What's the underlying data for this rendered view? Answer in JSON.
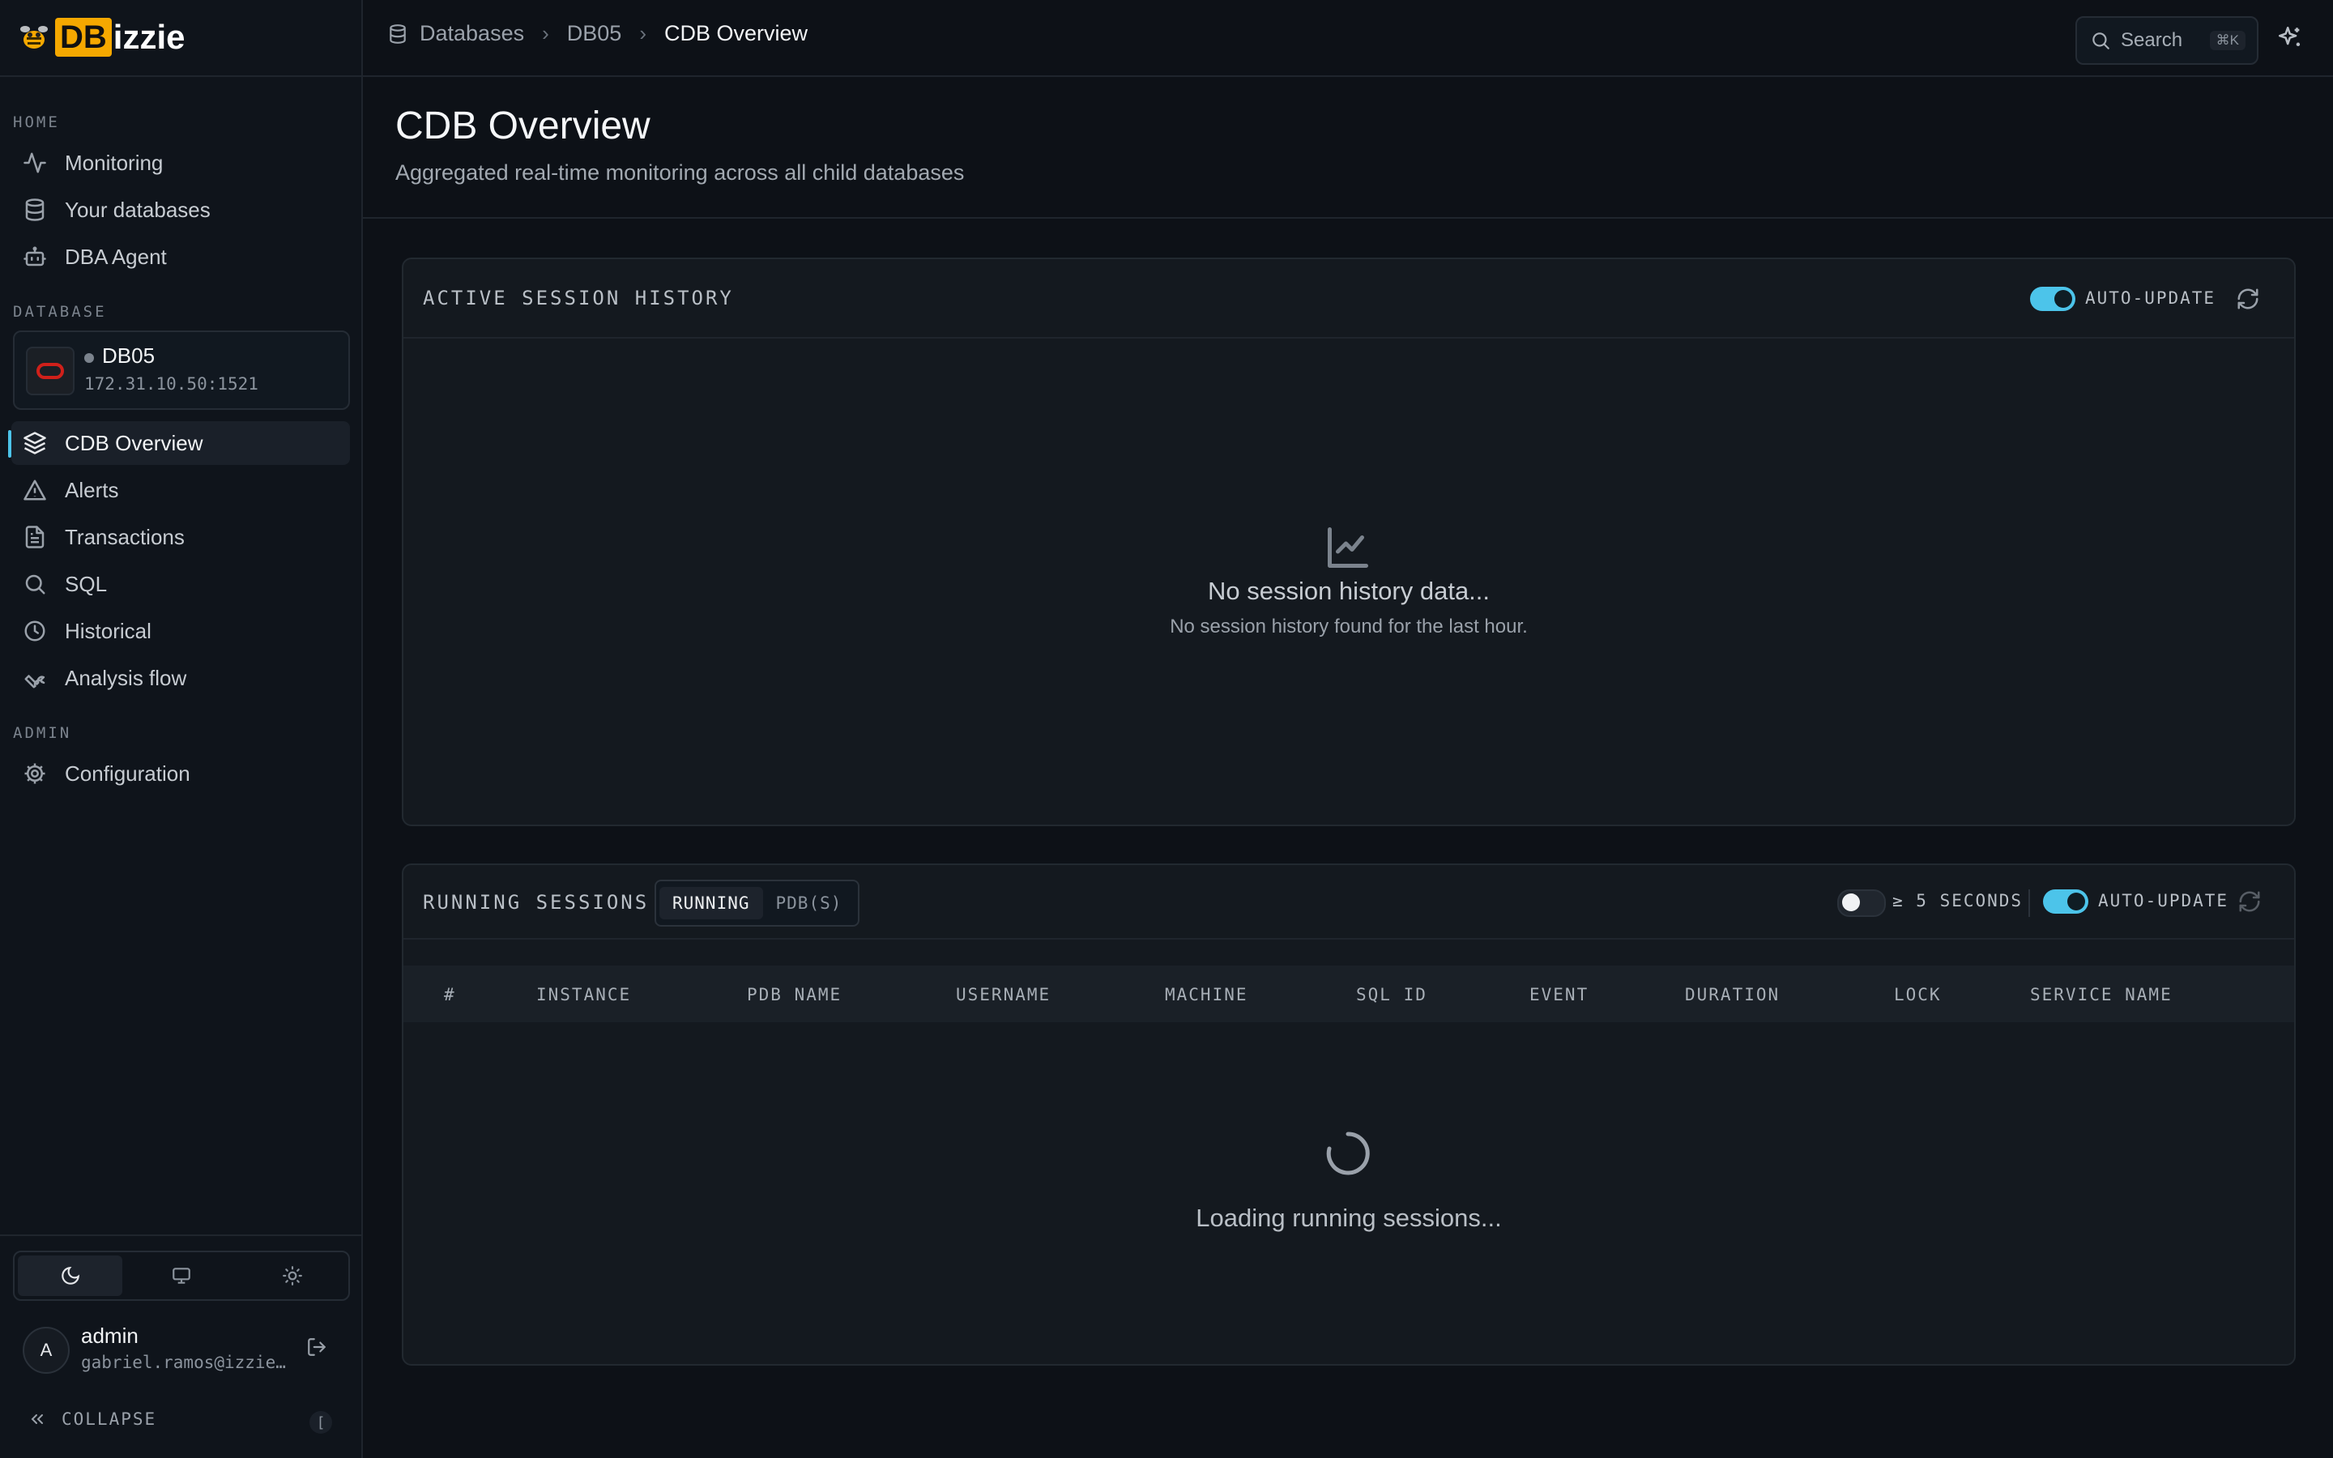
{
  "app": {
    "logo_db": "DB",
    "logo_rest": "izzie"
  },
  "sidebar": {
    "sections": {
      "home": "HOME",
      "database": "DATABASE",
      "admin": "ADMIN"
    },
    "home_items": [
      {
        "label": "Monitoring",
        "icon": "activity-icon"
      },
      {
        "label": "Your databases",
        "icon": "database-icon"
      },
      {
        "label": "DBA Agent",
        "icon": "bot-icon"
      }
    ],
    "database": {
      "name": "DB05",
      "host": "172.31.10.50:1521",
      "status_color": "#7b838d"
    },
    "database_items": [
      {
        "label": "CDB Overview",
        "icon": "layers-icon",
        "active": true
      },
      {
        "label": "Alerts",
        "icon": "alert-triangle-icon"
      },
      {
        "label": "Transactions",
        "icon": "file-text-icon"
      },
      {
        "label": "SQL",
        "icon": "search-icon"
      },
      {
        "label": "Historical",
        "icon": "clock-icon"
      },
      {
        "label": "Analysis flow",
        "icon": "wrench-icon"
      }
    ],
    "admin_items": [
      {
        "label": "Configuration",
        "icon": "gear-icon"
      }
    ],
    "theme": {
      "selected": "dark",
      "options": [
        "dark",
        "system",
        "light"
      ]
    },
    "user": {
      "initial": "A",
      "name": "admin",
      "email": "gabriel.ramos@izzie…"
    },
    "collapse_label": "COLLAPSE",
    "collapse_key": "["
  },
  "topbar": {
    "breadcrumb": [
      "Databases",
      "DB05",
      "CDB Overview"
    ],
    "search_label": "Search",
    "search_shortcut": "⌘K"
  },
  "header": {
    "title": "CDB Overview",
    "subtitle": "Aggregated real-time monitoring across all child databases"
  },
  "ash_panel": {
    "title": "ACTIVE SESSION HISTORY",
    "auto_update_label": "AUTO-UPDATE",
    "auto_update_on": true,
    "empty_title": "No session history data...",
    "empty_subtitle": "No session history found for the last hour."
  },
  "running_panel": {
    "title": "RUNNING SESSIONS",
    "tabs": [
      "RUNNING",
      "PDB(S)"
    ],
    "active_tab": "RUNNING",
    "filter_label": "≥ 5 SECONDS",
    "filter_on": false,
    "auto_update_label": "AUTO-UPDATE",
    "auto_update_on": true,
    "columns": [
      "#",
      "INSTANCE",
      "PDB NAME",
      "USERNAME",
      "MACHINE",
      "SQL ID",
      "EVENT",
      "DURATION",
      "LOCK",
      "SERVICE NAME"
    ],
    "loading_text": "Loading running sessions..."
  },
  "colors": {
    "accent": "#4cc4ea",
    "brand": "#f5a800",
    "background": "#0d1117"
  }
}
